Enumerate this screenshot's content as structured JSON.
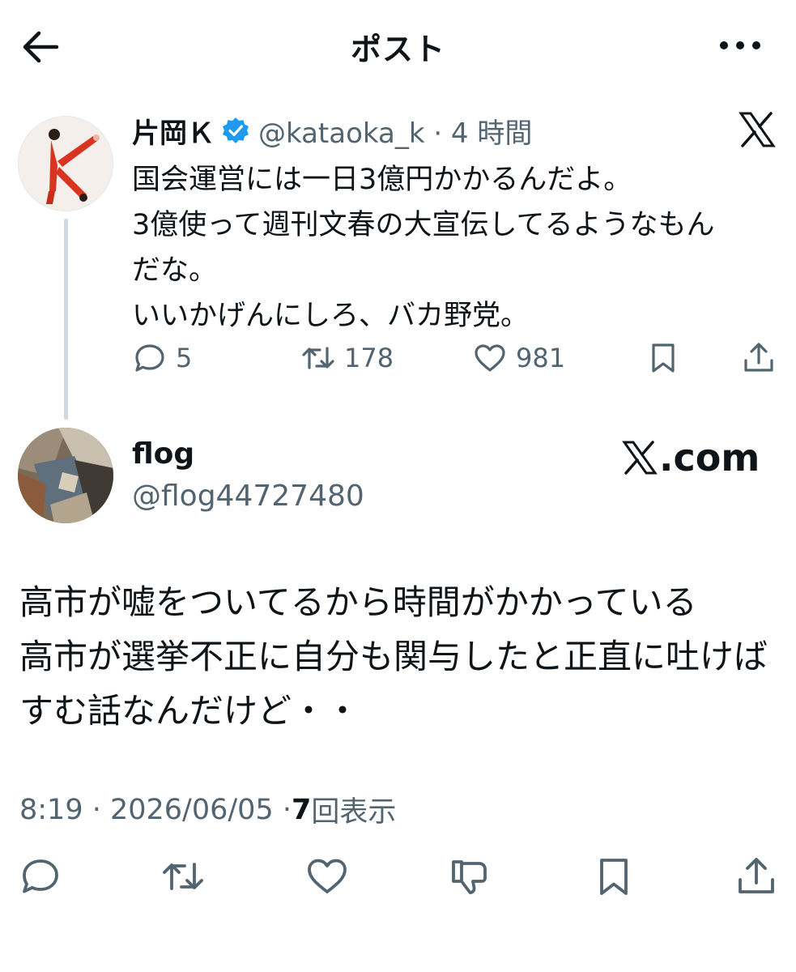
{
  "header": {
    "title": "ポスト",
    "back_icon": "arrow-left-icon",
    "more_icon": "more-horizontal-icon"
  },
  "parent_post": {
    "author_name": "片岡Ｋ",
    "verified": true,
    "handle_time": "@kataoka_k · 4 時間",
    "body_lines": [
      "国会運営には一日3億円かかるんだよ。",
      "3億使って週刊文春の大宣伝してるようなもん",
      "だな。",
      "いいかげんにしろ、バカ野党。"
    ],
    "replies": "5",
    "reposts": "178",
    "likes": "981"
  },
  "reply_post": {
    "author_name": "flog",
    "handle": "@flog44727480",
    "watermark": ".com",
    "body_lines": [
      "高市が嘘をついてるから時間がかかっている",
      "高市が選挙不正に自分も関与したと正直に吐けば",
      "すむ話なんだけど・・"
    ],
    "timestamp": "8:19 · 2026/06/05 · ",
    "views_count": "7",
    "views_label": " 回表示"
  },
  "colors": {
    "text": "#0f1419",
    "secondary": "#536471",
    "verified_blue": "#1d9bf0",
    "thread_line": "#cfd9de"
  }
}
